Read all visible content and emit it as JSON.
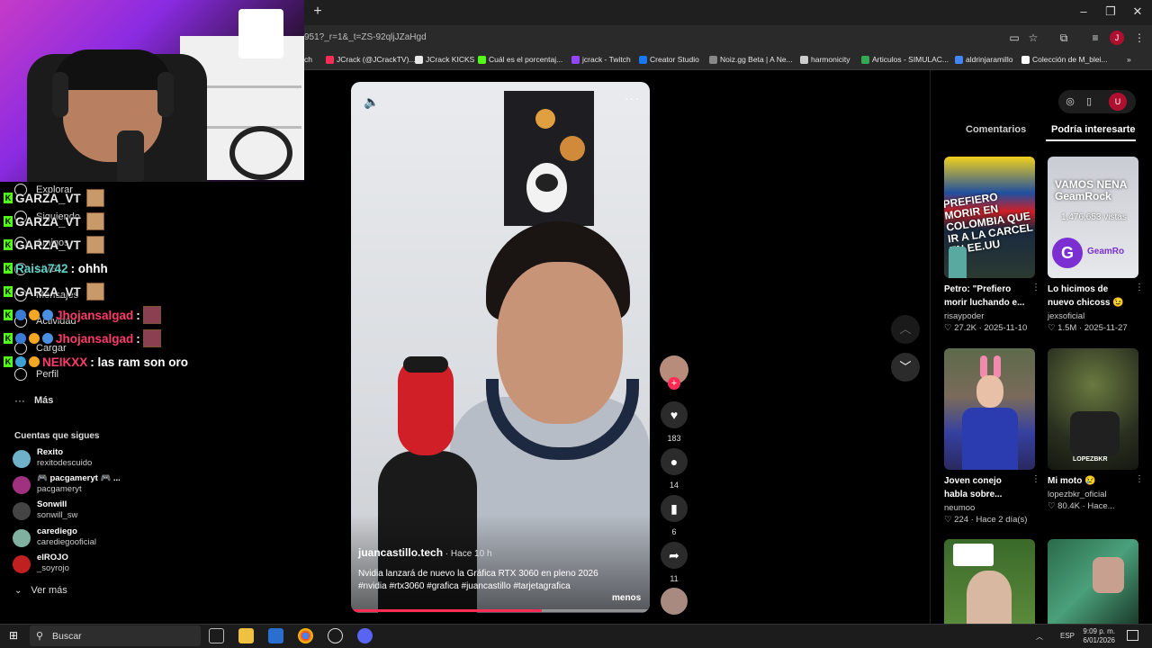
{
  "browser": {
    "url": "951?_r=1&_t=ZS-92qljJZaHgd",
    "new_tab": "+",
    "bookmarks": [
      {
        "label": "ch"
      },
      {
        "label": "JCrack (@JCrackTV)...",
        "color": "#ff2d55"
      },
      {
        "label": "JCrack KICKS",
        "color": "#e8e8e8"
      },
      {
        "label": "Cuál es el porcentaj...",
        "color": "#53fc18"
      },
      {
        "label": "jcrack - Twitch",
        "color": "#9146ff"
      },
      {
        "label": "Creator Studio",
        "color": "#1877f2"
      },
      {
        "label": "Noiz.gg Beta | A Ne...",
        "color": "#888888"
      },
      {
        "label": "harmonicity",
        "color": "#cccccc"
      },
      {
        "label": "Articulos - SIMULAC...",
        "color": "#34a853"
      },
      {
        "label": "aldrinjaramillo",
        "color": "#4285f4"
      },
      {
        "label": "Colección de M_blei...",
        "color": "#ffffff"
      }
    ],
    "bookmarks_more": "»"
  },
  "sidebar": {
    "nav": [
      {
        "label": "Explorar",
        "key": "explorar"
      },
      {
        "label": "Siguiendo",
        "key": "siguiendo"
      },
      {
        "label": "Amigos",
        "key": "amigos"
      },
      {
        "label": "LIVE",
        "key": "live"
      },
      {
        "label": "Mensajes",
        "key": "mensajes"
      },
      {
        "label": "Actividad",
        "key": "actividad"
      },
      {
        "label": "Cargar",
        "key": "cargar"
      },
      {
        "label": "Perfil",
        "key": "perfil"
      },
      {
        "label": "Más",
        "key": "mas"
      }
    ],
    "following_title": "Cuentas que sigues",
    "following": [
      {
        "name": "Rexito",
        "handle": "rexitodescuido",
        "color": "#6fb1c9"
      },
      {
        "name": "🎮 pacgameryt 🎮 ...",
        "handle": "pacgameryt",
        "color": "#a03080"
      },
      {
        "name": "Sonwill",
        "handle": "sonwill_sw",
        "color": "#444444"
      },
      {
        "name": "carediego",
        "handle": "carediegooficial",
        "color": "#7fb0a0"
      },
      {
        "name": "elROJO",
        "handle": "_soyrojo",
        "color": "#c02020"
      }
    ],
    "see_more": "Ver más"
  },
  "chat": [
    {
      "user": "GARZA_VT",
      "text": "",
      "color": "#e8e8e8",
      "emote": true
    },
    {
      "user": "GARZA_VT",
      "text": "",
      "color": "#e8e8e8",
      "emote": true
    },
    {
      "user": "GARZA_VT",
      "text": "",
      "color": "#e8e8e8",
      "emote": true
    },
    {
      "user": "Raisa742",
      "text": ": ohhh",
      "color": "#5fd3c8",
      "emote": false
    },
    {
      "user": "GARZA_VT",
      "text": "",
      "color": "#e8e8e8",
      "emote": true
    },
    {
      "user": "Jhojansalgad",
      "text": ":",
      "color": "#ff3b6b",
      "emote": true
    },
    {
      "user": "Jhojansalgad",
      "text": ":",
      "color": "#ff3b6b",
      "emote": true
    },
    {
      "user": "NEIKXX",
      "text": ": las ram son oro",
      "color": "#ff3b6b",
      "emote": false
    }
  ],
  "video": {
    "author": "juancastillo.tech",
    "time": " · Hace 10 h",
    "description": "Nvidia lanzará de nuevo la Gráfica RTX 3060 en pleno 2026 #nvidia #rtx3060 #grafica #juancastillo #tarjetagrafica",
    "less_label": "menos",
    "progress": 0.64
  },
  "actions": {
    "likes": "183",
    "comments": "14",
    "saves": "6",
    "shares": "11"
  },
  "right_panel": {
    "tabs": [
      "Comentarios",
      "Podría interesarte"
    ],
    "active_tab": "Podría interesarte",
    "cards": [
      {
        "title": "Petro: \"Prefiero",
        "title2": "morir luchando e...",
        "author": "risaypoder",
        "meta": "♡ 27.2K · 2025-11-10",
        "thumb_text": "PREFIERO MORIR EN COLOMBIA QUE IR A LA CARCEL EN EE.UU"
      },
      {
        "title": "Lo hicimos de",
        "title2": "nuevo chicoss 😉",
        "author": "jexsoficial",
        "meta": "♡ 1.5M · 2025-11-27",
        "thumb_text": "VAMOS NENA GeamRock",
        "thumb_sub": "1,476,653 vistas",
        "thumb_badge": "G",
        "thumb_badge2": "GeamRo"
      },
      {
        "title": "Joven conejo",
        "title2": "habla sobre...",
        "author": "neumoo",
        "meta": "♡ 224 · Hace 2 día(s)"
      },
      {
        "title": "Mi moto 😢",
        "title2": "",
        "author": "lopezbkr_oficial",
        "meta": "♡ 80.4K · Hace...",
        "thumb_text": "LOPEZBKR"
      },
      {
        "title": "",
        "title2": "",
        "author": "",
        "meta": ""
      },
      {
        "title": "",
        "title2": "",
        "author": "",
        "meta": ""
      }
    ]
  },
  "taskbar": {
    "search_placeholder": "Buscar",
    "lang": "ESP",
    "time": "9:09 p. m.",
    "date": "6/01/2026"
  }
}
